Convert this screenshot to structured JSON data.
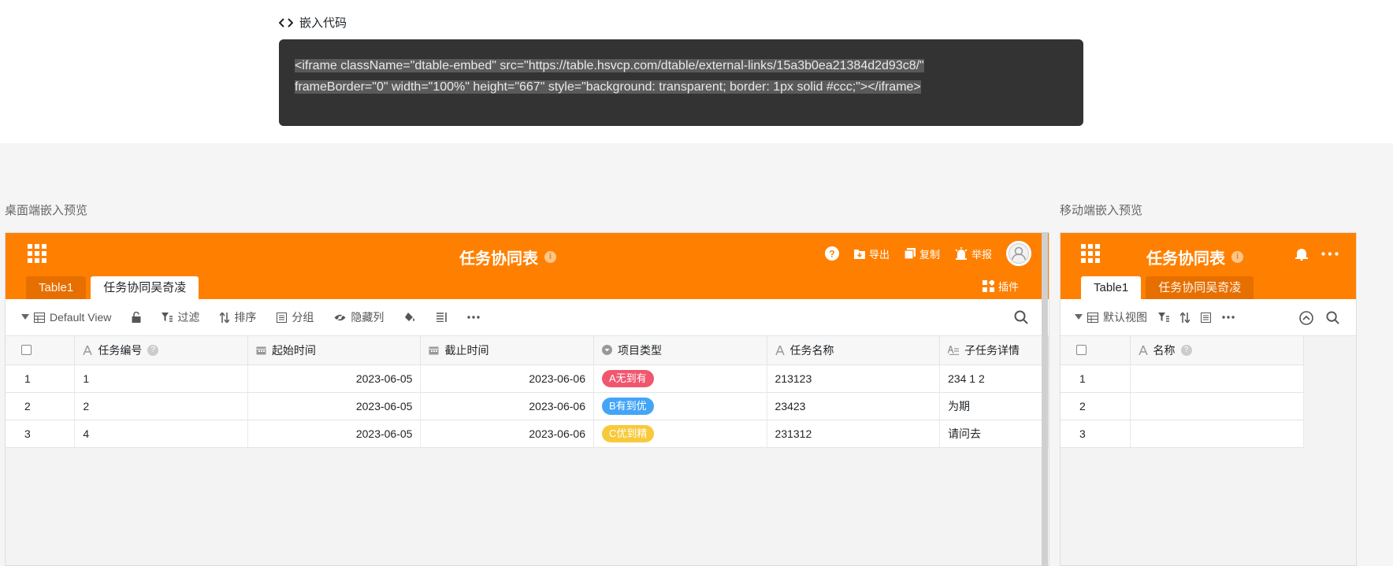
{
  "embed": {
    "heading": "嵌入代码",
    "code_line1": "<iframe className=\"dtable-embed\" src=\"https://table.hsvcp.com/dtable/external-links/15a3b0ea21384d2d93c8/\"",
    "code_line2": "frameBorder=\"0\" width=\"100%\" height=\"667\" style=\"background: transparent; border: 1px solid #ccc;\"></iframe>"
  },
  "desktop": {
    "section_label": "桌面端嵌入预览",
    "title": "任务协同表",
    "actions": {
      "export": "导出",
      "copy": "复制",
      "report": "举报"
    },
    "tabs": [
      "Table1",
      "任务协同吴奇凌"
    ],
    "plugin_label": "插件",
    "toolbar": {
      "view": "Default View",
      "filter": "过滤",
      "sort": "排序",
      "group": "分组",
      "hide": "隐藏列"
    },
    "columns": [
      "任务编号",
      "起始时间",
      "截止时间",
      "项目类型",
      "任务名称",
      "子任务详情"
    ],
    "rows": [
      {
        "idx": "1",
        "task_no": "1",
        "start": "2023-06-05",
        "end": "2023-06-06",
        "type": "A无到有",
        "name": "213123",
        "detail": "234 1 2"
      },
      {
        "idx": "2",
        "task_no": "2",
        "start": "2023-06-05",
        "end": "2023-06-06",
        "type": "B有到优",
        "name": "23423",
        "detail": "为期"
      },
      {
        "idx": "3",
        "task_no": "4",
        "start": "2023-06-05",
        "end": "2023-06-06",
        "type": "C优到精",
        "name": "231312",
        "detail": "请问去"
      }
    ]
  },
  "mobile": {
    "section_label": "移动端嵌入预览",
    "title": "任务协同表",
    "tabs": [
      "Table1",
      "任务协同吴奇凌"
    ],
    "view": "默认视图",
    "column": "名称",
    "rows": [
      "1",
      "2",
      "3"
    ]
  },
  "colors": {
    "brand": "#ff8000",
    "pill_a": "#f0576f",
    "pill_b": "#44a5f7",
    "pill_c": "#f7c93b"
  }
}
